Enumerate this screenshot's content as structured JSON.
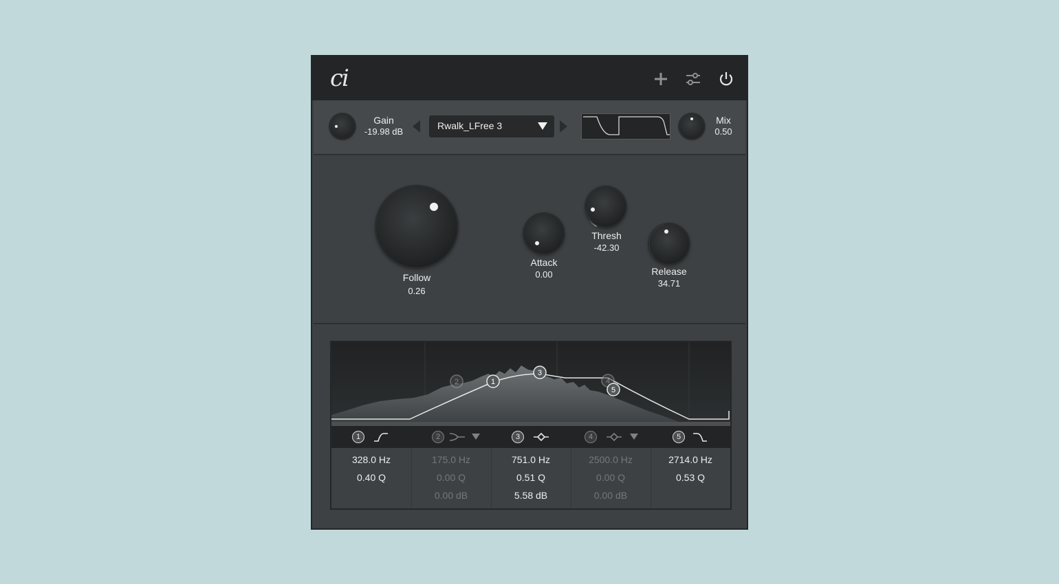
{
  "header": {
    "logo": "ci",
    "icons": [
      "plus-icon",
      "sliders-icon",
      "power-icon"
    ]
  },
  "topbar": {
    "gain": {
      "label": "Gain",
      "value": "-19.98 dB"
    },
    "preset": {
      "name": "Rwalk_LFree 3"
    },
    "mix": {
      "label": "Mix",
      "value": "0.50"
    }
  },
  "knobs": {
    "follow": {
      "label": "Follow",
      "value": "0.26"
    },
    "attack": {
      "label": "Attack",
      "value": "0.00"
    },
    "thresh": {
      "label": "Thresh",
      "value": "-42.30"
    },
    "release": {
      "label": "Release",
      "value": "34.71"
    }
  },
  "eq": {
    "graph_nodes": [
      "2",
      "1",
      "3",
      "4",
      "5"
    ],
    "bands": [
      {
        "num": "1",
        "type_icon": "highpass-icon",
        "freq": "328.0 Hz",
        "q": "0.40 Q",
        "gain": "",
        "active": true
      },
      {
        "num": "2",
        "type_icon": "shelf-icon",
        "freq": "175.0 Hz",
        "q": "0.00 Q",
        "gain": "0.00 dB",
        "active": false
      },
      {
        "num": "3",
        "type_icon": "bell-icon",
        "freq": "751.0 Hz",
        "q": "0.51 Q",
        "gain": "5.58 dB",
        "active": true
      },
      {
        "num": "4",
        "type_icon": "bell-icon",
        "freq": "2500.0 Hz",
        "q": "0.00 Q",
        "gain": "0.00 dB",
        "active": false
      },
      {
        "num": "5",
        "type_icon": "lowpass-icon",
        "freq": "2714.0 Hz",
        "q": "0.53 Q",
        "gain": "",
        "active": true
      }
    ]
  },
  "colors": {
    "background": "#c2d9dc",
    "panel": "#3d4143",
    "header": "#232526",
    "text": "#eeeeee",
    "dim_text": "#74787a"
  }
}
